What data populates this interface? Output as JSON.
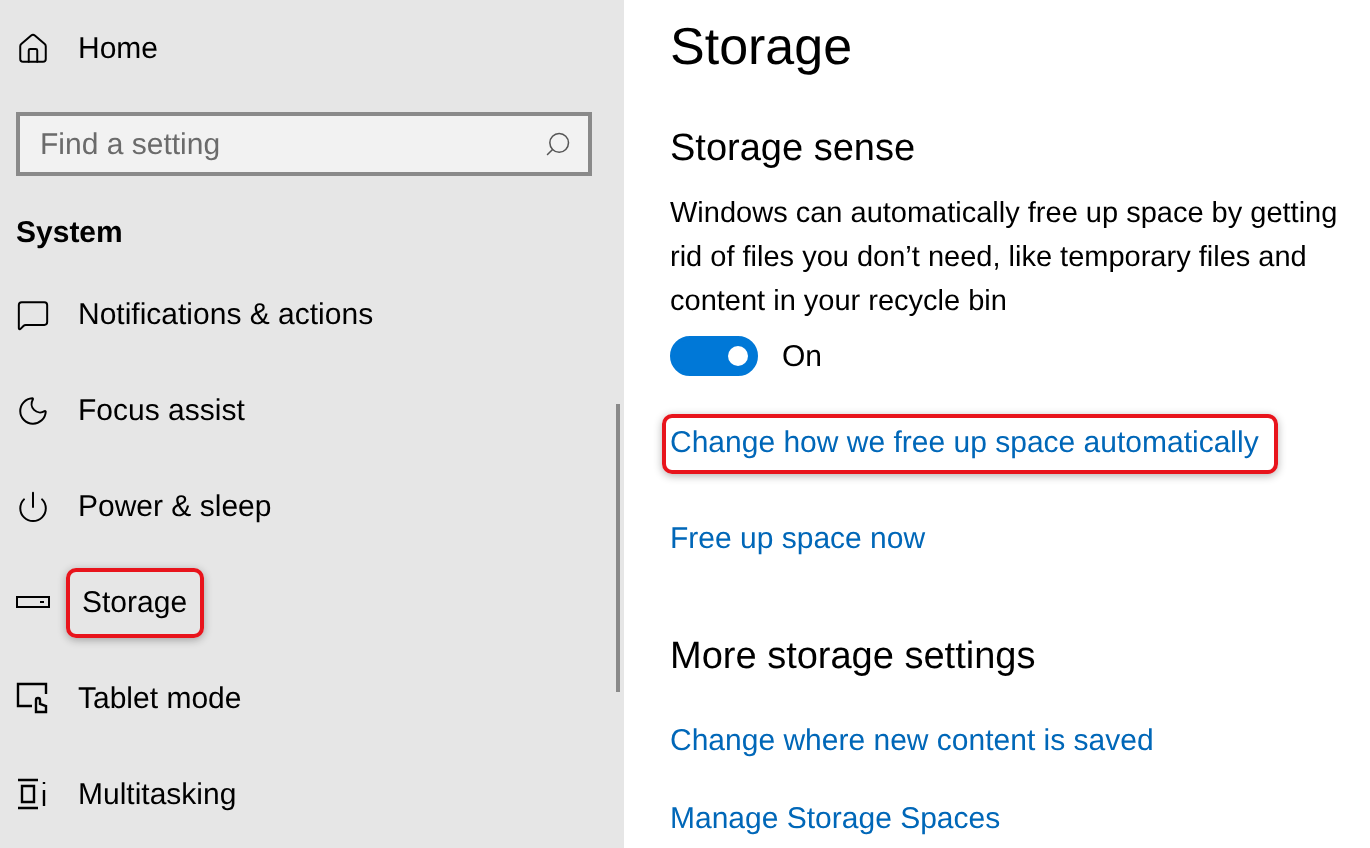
{
  "sidebar": {
    "home": "Home",
    "search": {
      "placeholder": "Find a setting"
    },
    "section": "System",
    "items": [
      {
        "label": "Notifications & actions",
        "kind": "notifications",
        "highlighted": false
      },
      {
        "label": "Focus assist",
        "kind": "focus",
        "highlighted": false
      },
      {
        "label": "Power & sleep",
        "kind": "power",
        "highlighted": false
      },
      {
        "label": "Storage",
        "kind": "storage",
        "highlighted": true
      },
      {
        "label": "Tablet mode",
        "kind": "tablet",
        "highlighted": false
      },
      {
        "label": "Multitasking",
        "kind": "multitasking",
        "highlighted": false
      }
    ]
  },
  "main": {
    "title": "Storage",
    "sense": {
      "heading": "Storage sense",
      "description": "Windows can automatically free up space by getting rid of files you don’t need, like temporary files and content in your recycle bin",
      "toggle": {
        "on": true,
        "label": "On"
      },
      "links": [
        {
          "label": "Change how we free up space automatically",
          "highlighted": true
        },
        {
          "label": "Free up space now",
          "highlighted": false
        }
      ]
    },
    "more": {
      "heading": "More storage settings",
      "links": [
        {
          "label": "Change where new content is saved",
          "highlighted": false
        },
        {
          "label": "Manage Storage Spaces",
          "highlighted": false
        }
      ]
    }
  }
}
